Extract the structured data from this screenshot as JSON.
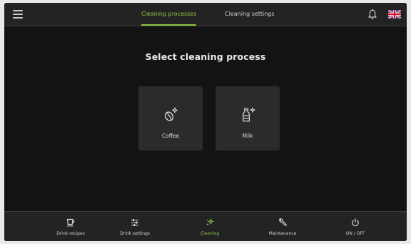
{
  "header": {
    "tabs": [
      {
        "label": "Cleaning processes",
        "active": true
      },
      {
        "label": "Cleaning settings",
        "active": false
      }
    ],
    "menu_icon": "hamburger-menu-icon",
    "notification_icon": "bell-icon",
    "language_icon": "uk-flag-icon"
  },
  "main": {
    "title": "Select cleaning process",
    "options": [
      {
        "label": "Coffee",
        "icon": "coffee-bean-sparkle-icon"
      },
      {
        "label": "Milk",
        "icon": "milk-bottle-sparkle-icon"
      }
    ]
  },
  "bottom_nav": {
    "items": [
      {
        "label": "Drink recipes",
        "icon": "cup-icon",
        "active": false
      },
      {
        "label": "Drink settings",
        "icon": "sliders-icon",
        "active": false
      },
      {
        "label": "Cleaning",
        "icon": "sparkle-icon",
        "active": true
      },
      {
        "label": "Maintenance",
        "icon": "wrench-icon",
        "active": false
      },
      {
        "label": "ON / OFF",
        "icon": "power-icon",
        "active": false
      }
    ]
  },
  "colors": {
    "accent": "#8dc63f",
    "background": "#131313",
    "bar": "#232323",
    "card": "#2b2b2b",
    "text": "#e8e8e8"
  }
}
